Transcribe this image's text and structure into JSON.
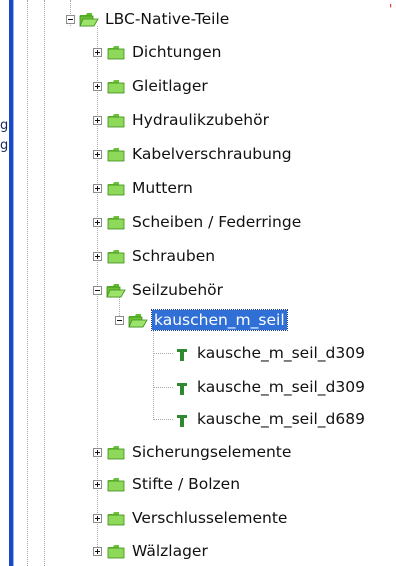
{
  "left_pane": {
    "fragments": [
      "g",
      "g"
    ]
  },
  "tree": {
    "root": {
      "label": "LBC-Native-Teile",
      "icon": "folder-open-icon"
    },
    "children": [
      {
        "label": "Dichtungen",
        "icon": "folder-icon",
        "expander": "+"
      },
      {
        "label": "Gleitlager",
        "icon": "folder-icon",
        "expander": "+"
      },
      {
        "label": "Hydraulikzubehör",
        "icon": "folder-icon",
        "expander": "+"
      },
      {
        "label": "Kabelverschraubung",
        "icon": "folder-icon",
        "expander": "+"
      },
      {
        "label": "Muttern",
        "icon": "folder-icon",
        "expander": "+"
      },
      {
        "label": "Scheiben / Federringe",
        "icon": "folder-icon",
        "expander": "+"
      },
      {
        "label": "Schrauben",
        "icon": "folder-icon",
        "expander": "+"
      },
      {
        "label": "Seilzubehör",
        "icon": "folder-open-icon",
        "expander": "-",
        "children": [
          {
            "label": "kauschen_m_seil",
            "icon": "folder-open-icon",
            "expander": "-",
            "selected": true,
            "children": [
              {
                "label": "kausche_m_seil_d309",
                "icon": "part-icon"
              },
              {
                "label": "kausche_m_seil_d309",
                "icon": "part-icon"
              },
              {
                "label": "kausche_m_seil_d689",
                "icon": "part-icon"
              }
            ]
          }
        ]
      },
      {
        "label": "Sicherungselemente",
        "icon": "folder-icon",
        "expander": "+"
      },
      {
        "label": "Stifte / Bolzen",
        "icon": "folder-icon",
        "expander": "+"
      },
      {
        "label": "Verschlusselemente",
        "icon": "folder-icon",
        "expander": "+"
      },
      {
        "label": "Wälzlager",
        "icon": "folder-icon",
        "expander": "+"
      }
    ]
  },
  "colors": {
    "selection": "#2f6fd6",
    "folder_green": "#7fd24a",
    "pane_border_blue": "#1948c8",
    "part_green": "#2f8a2f"
  }
}
